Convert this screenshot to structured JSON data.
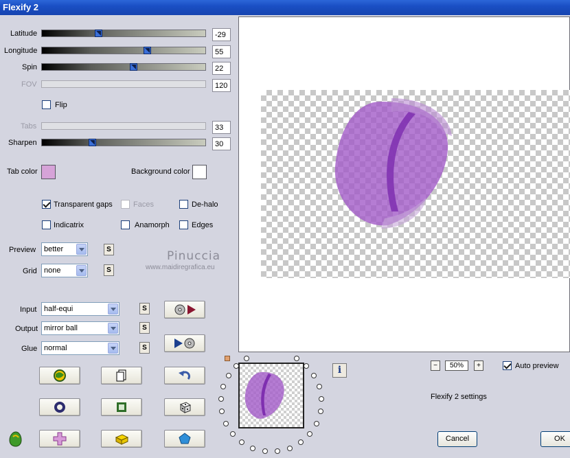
{
  "window": {
    "title": "Flexify 2"
  },
  "sliders": [
    {
      "label": "Latitude",
      "value": "-29",
      "level": 0.35,
      "enabled": true
    },
    {
      "label": "Longitude",
      "value": "55",
      "level": 0.65,
      "enabled": true
    },
    {
      "label": "Spin",
      "value": "22",
      "level": 0.56,
      "enabled": true
    },
    {
      "label": "FOV",
      "value": "120",
      "enabled": false
    },
    {
      "label": "Tabs",
      "value": "33",
      "enabled": false
    },
    {
      "label": "Sharpen",
      "value": "30",
      "level": 0.31,
      "enabled": true
    }
  ],
  "flip": {
    "label": "Flip",
    "checked": false
  },
  "tab_color": {
    "label": "Tab color",
    "color": "#d6a3d8"
  },
  "background_color": {
    "label": "Background color",
    "color": "#ffffff"
  },
  "options": {
    "transparent_gaps": {
      "label": "Transparent gaps",
      "checked": true
    },
    "faces": {
      "label": "Faces",
      "checked": false,
      "enabled": false
    },
    "de_halo": {
      "label": "De-halo",
      "checked": false
    },
    "indicatrix": {
      "label": "Indicatrix",
      "checked": false
    },
    "anamorph": {
      "label": "Anamorph",
      "checked": false
    },
    "edges": {
      "label": "Edges",
      "checked": false
    }
  },
  "preview_select": {
    "label": "Preview",
    "value": "better",
    "s": "S"
  },
  "grid_select": {
    "label": "Grid",
    "value": "none",
    "s": "S"
  },
  "input_select": {
    "label": "Input",
    "value": "half-equi",
    "s": "S"
  },
  "output_select": {
    "label": "Output",
    "value": "mirror ball",
    "s": "S"
  },
  "glue_select": {
    "label": "Glue",
    "value": "normal",
    "s": "S"
  },
  "watermark": {
    "line1": "Pinuccia",
    "line2": "www.maidiregrafica.eu"
  },
  "zoom": {
    "minus": "−",
    "value": "50%",
    "plus": "+"
  },
  "auto_preview": {
    "label": "Auto preview",
    "checked": true
  },
  "settings_name": "Flexify 2 settings",
  "info_button": "i",
  "cancel_label": "Cancel",
  "ok_label": "OK",
  "colors": {
    "purple": "#a25bc8",
    "purple_dark": "#7f2fb0",
    "title_blue": "#1a4fc4"
  }
}
